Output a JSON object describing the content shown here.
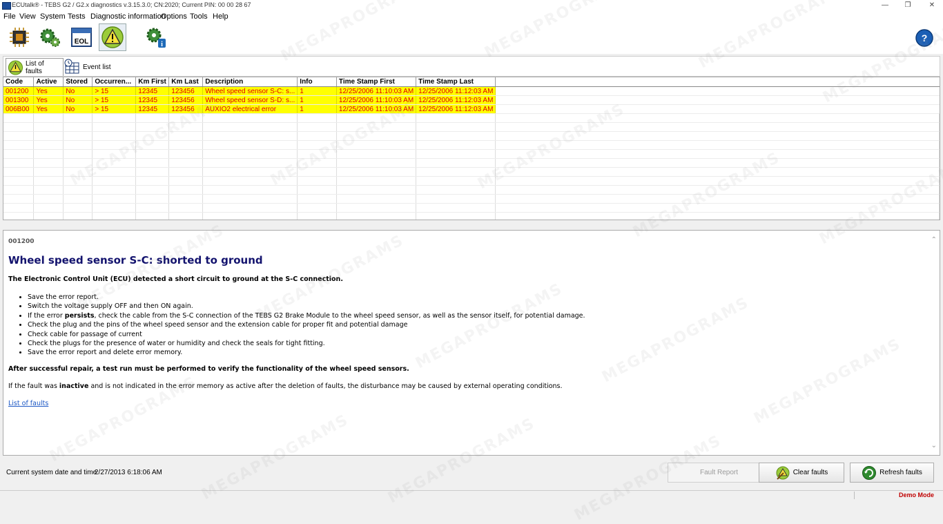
{
  "window": {
    "title": "ECUtalk® - TEBS G2 / G2.x diagnostics v.3.15.3.0; CN:2020; Current PIN: 00 00 28 67",
    "minimize": "—",
    "maximize": "❐",
    "close": "✕"
  },
  "menu": [
    "File",
    "View",
    "System",
    "Tests",
    "Diagnostic information",
    "Options",
    "Tools",
    "Help"
  ],
  "toolbar": {
    "eol_label": "EOL",
    "icons": [
      "ecu-chip-icon",
      "gears-icon",
      "eol-icon",
      "warning-icon",
      "gear-info-icon"
    ],
    "help_icon": "help-icon"
  },
  "tabs": [
    {
      "label": "List of faults",
      "icon": "warning-icon"
    },
    {
      "label": "Event list",
      "icon": "table-clock-icon"
    }
  ],
  "table": {
    "columns": [
      "Code",
      "Active",
      "Stored",
      "Occurren...",
      "Km First",
      "Km Last",
      "Description",
      "Info",
      "Time Stamp First",
      "Time Stamp Last"
    ],
    "rows": [
      [
        "001200",
        "Yes",
        "No",
        "> 15",
        "12345",
        "123456",
        "Wheel speed sensor S-C: s...",
        "1",
        "12/25/2006 11:10:03 AM",
        "12/25/2006 11:12:03 AM"
      ],
      [
        "001300",
        "Yes",
        "No",
        "> 15",
        "12345",
        "123456",
        "Wheel speed sensor S-D: s...",
        "1",
        "12/25/2006 11:10:03 AM",
        "12/25/2006 11:12:03 AM"
      ],
      [
        "006B00",
        "Yes",
        "No",
        "> 15",
        "12345",
        "123456",
        "AUXIO2 electrical error",
        "1",
        "12/25/2006 11:10:03 AM",
        "12/25/2006 11:12:03 AM"
      ]
    ]
  },
  "detail": {
    "code": "001200",
    "title": "Wheel speed sensor S-C: shorted to ground",
    "intro": "The Electronic Control Unit (ECU) detected a short circuit to ground at the S-C connection.",
    "steps": [
      {
        "text": "Save the error report."
      },
      {
        "text": "Switch the voltage supply OFF and then ON again."
      },
      {
        "pre": "If the error ",
        "bold": "persists",
        "post": ", check the cable from the S-C connection of the TEBS G2 Brake Module to the wheel speed sensor, as well as the sensor itself, for potential damage."
      },
      {
        "text": "Check the plug and the pins of the wheel speed sensor and the extension cable for proper fit and potential damage"
      },
      {
        "text": "Check cable for passage of current"
      },
      {
        "text": "Check the plugs for the presence of water or humidity and check the seals for tight fitting."
      },
      {
        "text": "Save the error report and delete error memory."
      }
    ],
    "after_repair": "After successful repair, a test run must be performed to verify the functionality of the wheel speed sensors.",
    "note_pre": "If the fault was ",
    "note_bold": "inactive",
    "note_post": " and is not indicated in the error memory as active after the deletion of faults, the disturbance may be caused by external operating conditions.",
    "link": "List of faults"
  },
  "footer": {
    "datetime_label": "Current system date and time",
    "datetime_value": "2/27/2013 6:18:06 AM",
    "fault_report": "Fault Report",
    "clear_faults": "Clear faults",
    "refresh_faults": "Refresh faults"
  },
  "status": {
    "mode": "Demo Mode"
  },
  "watermark": "MEGAPROGRAMS",
  "colors": {
    "fault_row_bg": "#ffff00",
    "fault_row_text": "#e00000",
    "detail_title": "#13136e",
    "link": "#1a56c4",
    "demo_mode": "#c00000"
  }
}
